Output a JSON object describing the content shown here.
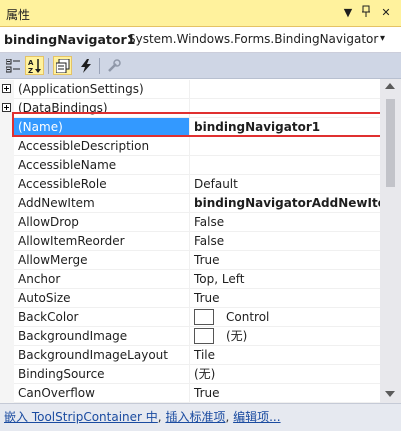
{
  "window": {
    "title": "属性"
  },
  "title_buttons": {
    "dropdown": "▼",
    "pin": "ᵖ",
    "close": "✕"
  },
  "object": {
    "name": "bindingNavigator1",
    "type": "System.Windows.Forms.BindingNavigator",
    "dropdown_glyph": "▾"
  },
  "toolbar": {
    "categorized": "categorized-icon",
    "alphabetical": "alphabetical-icon",
    "properties": "properties-icon",
    "events": "events-icon",
    "property_pages": "wrench-icon"
  },
  "rows": [
    {
      "name": "(ApplicationSettings)",
      "value": "",
      "expandable": true
    },
    {
      "name": "(DataBindings)",
      "value": "",
      "expandable": true
    },
    {
      "name": "(Name)",
      "value": "bindingNavigator1",
      "selected": true,
      "bold": true
    },
    {
      "name": "AccessibleDescription",
      "value": ""
    },
    {
      "name": "AccessibleName",
      "value": ""
    },
    {
      "name": "AccessibleRole",
      "value": "Default"
    },
    {
      "name": "AddNewItem",
      "value": "bindingNavigatorAddNewIter",
      "bold": true
    },
    {
      "name": "AllowDrop",
      "value": "False"
    },
    {
      "name": "AllowItemReorder",
      "value": "False"
    },
    {
      "name": "AllowMerge",
      "value": "True"
    },
    {
      "name": "Anchor",
      "value": "Top, Left"
    },
    {
      "name": "AutoSize",
      "value": "True"
    },
    {
      "name": "BackColor",
      "value": "Control",
      "swatch": true
    },
    {
      "name": "BackgroundImage",
      "value": "(无)",
      "swatch": true
    },
    {
      "name": "BackgroundImageLayout",
      "value": "Tile"
    },
    {
      "name": "BindingSource",
      "value": "(无)"
    },
    {
      "name": "CanOverflow",
      "value": "True"
    }
  ],
  "commands": {
    "embed": "嵌入 ToolStripContainer 中",
    "sep1": ", ",
    "insert": "插入标准项",
    "sep2": ", ",
    "edit": "编辑项..."
  },
  "colors": {
    "title_bg": "#fff29d",
    "selection": "#3399ff",
    "highlight_box": "#e03030"
  }
}
